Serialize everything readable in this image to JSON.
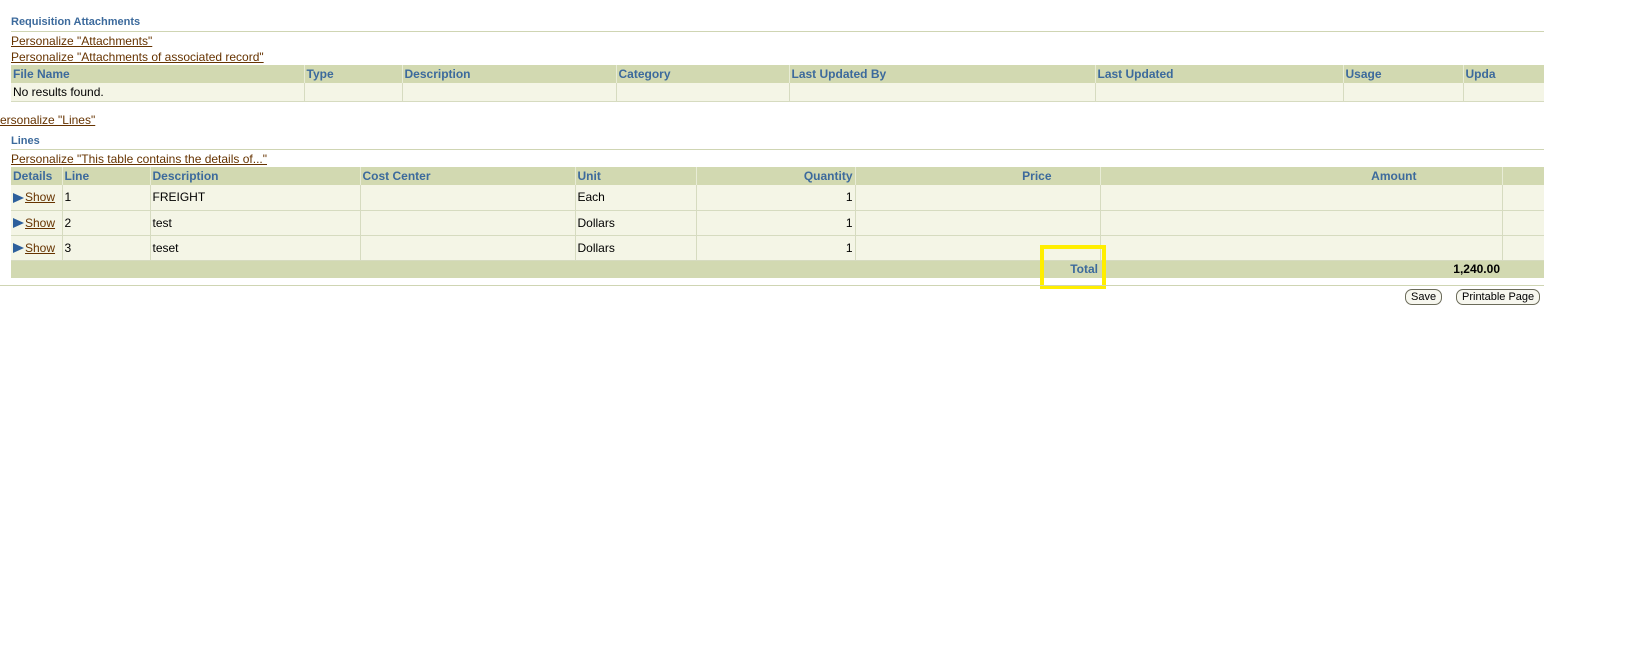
{
  "attachments": {
    "title": "Requisition Attachments",
    "personalize_links": [
      "Personalize \"Attachments\"",
      "Personalize \"Attachments of associated record\""
    ],
    "columns": [
      "File Name",
      "Type",
      "Description",
      "Category",
      "Last Updated By",
      "Last Updated",
      "Usage",
      "Upda"
    ],
    "empty_text": "No results found."
  },
  "personalize_lines": "ersonalize \"Lines\"",
  "lines": {
    "title": "Lines",
    "personalize_link": "Personalize \"This table contains the details of...\"",
    "columns": [
      "Details",
      "Line",
      "Description",
      "Cost Center",
      "Unit",
      "Quantity",
      "Price",
      "Amount"
    ],
    "rows": [
      {
        "details": "Show",
        "line": "1",
        "description": "FREIGHT",
        "cost_center": "",
        "unit": "Each",
        "quantity": "1",
        "price": "",
        "amount": ""
      },
      {
        "details": "Show",
        "line": "2",
        "description": "test",
        "cost_center": "",
        "unit": "Dollars",
        "quantity": "1",
        "price": "",
        "amount": ""
      },
      {
        "details": "Show",
        "line": "3",
        "description": "teset",
        "cost_center": "",
        "unit": "Dollars",
        "quantity": "1",
        "price": "",
        "amount": ""
      }
    ],
    "total_label": "Total",
    "total_value": "1,240.00"
  },
  "buttons": {
    "save": "Save",
    "printable": "Printable Page"
  }
}
